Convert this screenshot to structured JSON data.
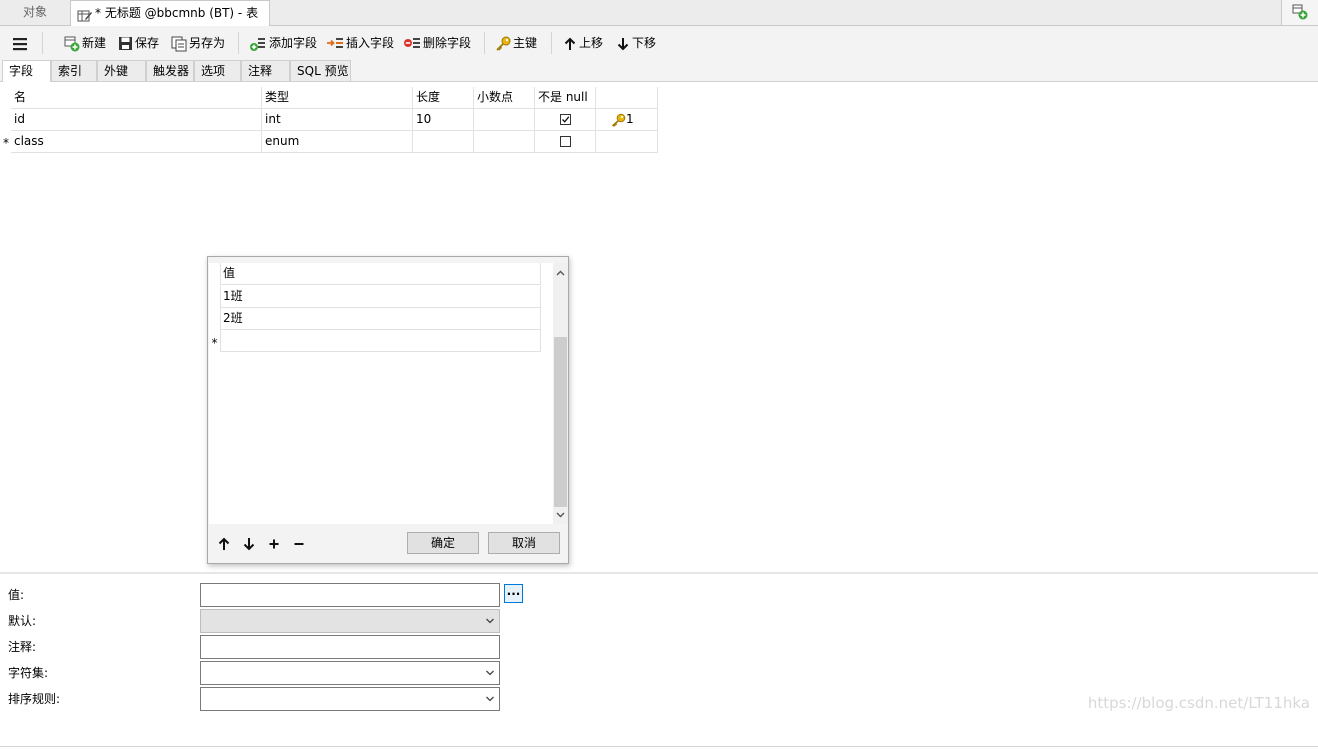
{
  "tabs": {
    "objects_label": "对象",
    "active_label": "* 无标题 @bbcmnb (BT) - 表"
  },
  "toolbar": {
    "new_label": "新建",
    "save_label": "保存",
    "save_as_label": "另存为",
    "add_field_label": "添加字段",
    "insert_field_label": "插入字段",
    "delete_field_label": "删除字段",
    "primary_key_label": "主键",
    "move_up_label": "上移",
    "move_down_label": "下移"
  },
  "subtabs": [
    "字段",
    "索引",
    "外键",
    "触发器",
    "选项",
    "注释",
    "SQL 预览"
  ],
  "grid": {
    "columns": [
      "名",
      "类型",
      "长度",
      "小数点",
      "不是 null",
      ""
    ],
    "rows": [
      {
        "marker": "",
        "name": "id",
        "type": "int",
        "length": "10",
        "decimals": "",
        "not_null": true,
        "key": "1"
      },
      {
        "marker": "*",
        "name": "class",
        "type": "enum",
        "length": "",
        "decimals": "",
        "not_null": false,
        "key": ""
      }
    ]
  },
  "enum_dialog": {
    "header": "值",
    "values": [
      "1班",
      "2班"
    ],
    "new_row_marker": "*",
    "ok_label": "确定",
    "cancel_label": "取消"
  },
  "properties": {
    "value_label": "值:",
    "default_label": "默认:",
    "comment_label": "注释:",
    "charset_label": "字符集:",
    "collation_label": "排序规则:",
    "ellipsis_label": "..."
  },
  "watermark": "https://blog.csdn.net/LT11hka",
  "colors": {
    "accent": "#0078d7",
    "key_icon": "#e8b60e",
    "add_icon": "#3aa63a",
    "delete_icon": "#d9342b"
  }
}
